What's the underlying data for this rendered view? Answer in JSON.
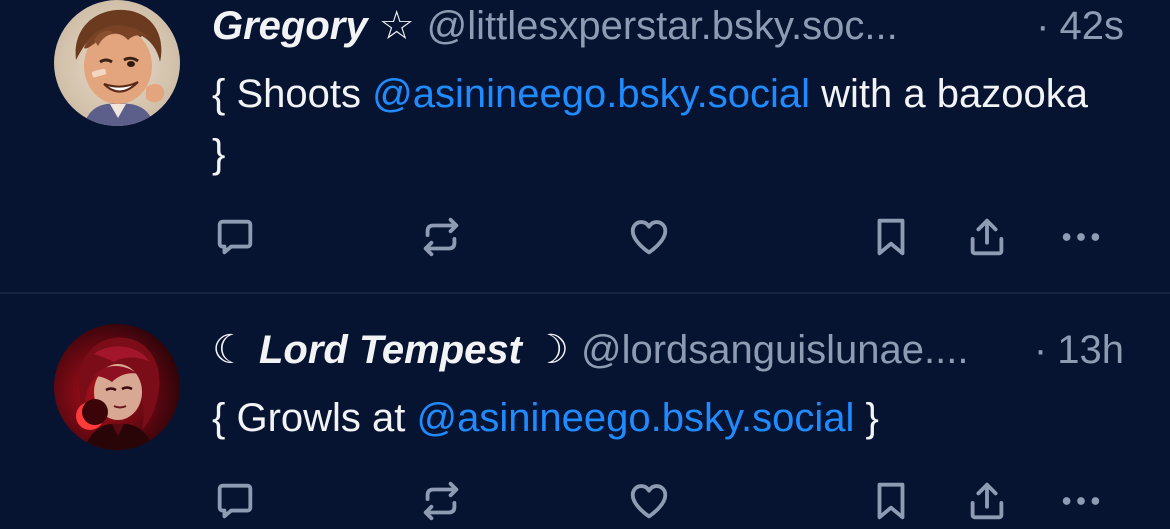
{
  "posts": [
    {
      "author": {
        "display_name": "Gregory",
        "name_suffix": " ☆",
        "handle": "@littlesxperstar.bsky.soc..."
      },
      "separator": "·",
      "time": "42s",
      "text": {
        "before": "{ Shoots ",
        "mention": "@asinineego.bsky.social",
        "after": " with a bazooka }"
      },
      "actions": [
        "reply-icon",
        "repost-icon",
        "like-icon",
        "bookmark-icon",
        "share-icon",
        "more-icon"
      ]
    },
    {
      "author": {
        "name_prefix": "☾ ",
        "display_name": "Lord Tempest",
        "name_suffix": " ☽",
        "handle": "@lordsanguislunae...."
      },
      "separator": "·",
      "time": "13h",
      "text": {
        "before": "{ Growls at ",
        "mention": "@asinineego.bsky.social",
        "after": " }"
      },
      "actions": [
        "reply-icon",
        "repost-icon",
        "like-icon",
        "bookmark-icon",
        "share-icon",
        "more-icon"
      ]
    }
  ],
  "colors": {
    "background": "#061331",
    "text": "#f1f3f5",
    "muted": "#8e9bb3",
    "mention": "#208bfe",
    "divider": "#17243f"
  }
}
